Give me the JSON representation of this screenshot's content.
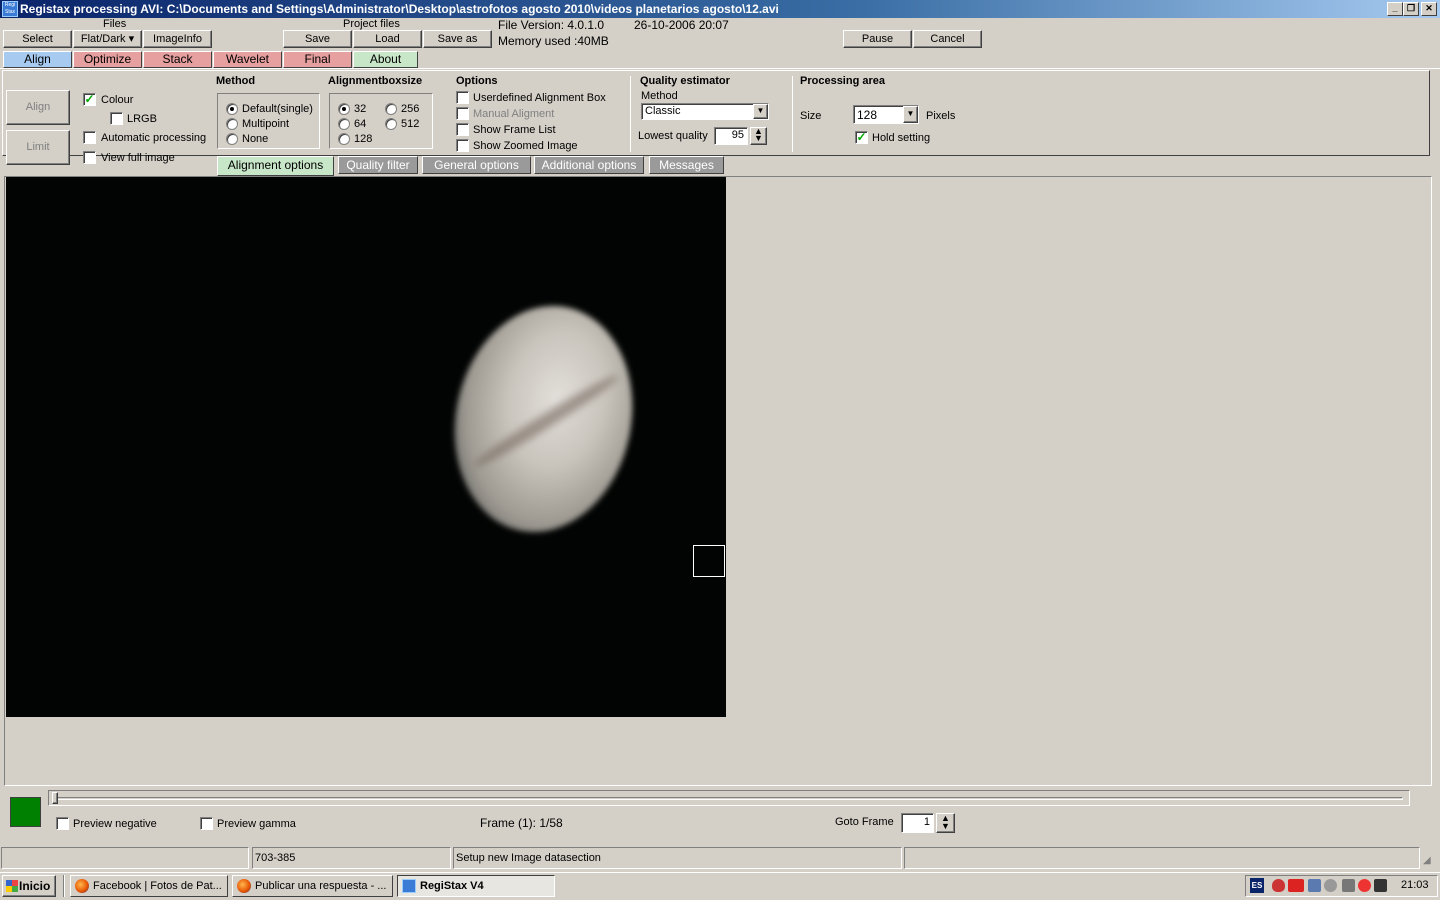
{
  "window": {
    "title": "Registax processing AVI: C:\\Documents and Settings\\Administrator\\Desktop\\astrofotos agosto 2010\\videos planetarios agosto\\12.avi",
    "icon_text": "Regi Stax"
  },
  "toolbar": {
    "select_label": "Select",
    "files_label": "Files",
    "flatdark_label": "Flat/Dark",
    "imageinfo_label": "ImageInfo",
    "project_files_label": "Project files",
    "save_label": "Save",
    "load_label": "Load",
    "saveas_label": "Save as",
    "file_version": "File Version: 4.0.1.0",
    "file_date": "26-10-2006 20:07",
    "memory_used": "Memory used :40MB",
    "pause_label": "Pause",
    "cancel_label": "Cancel"
  },
  "tabs": [
    {
      "label": "Align",
      "color": "#a6caf0"
    },
    {
      "label": "Optimize",
      "color": "#e6a0a0"
    },
    {
      "label": "Stack",
      "color": "#e6a0a0"
    },
    {
      "label": "Wavelet",
      "color": "#e6a0a0"
    },
    {
      "label": "Final",
      "color": "#e6a0a0"
    },
    {
      "label": "About",
      "color": "#c8e6c8"
    }
  ],
  "left": {
    "align_label": "Align",
    "limit_label": "Limit",
    "colour_label": "Colour",
    "colour_checked": true,
    "lrgb_label": "LRGB",
    "auto_label": "Automatic processing",
    "fullimage_label": "View full image"
  },
  "method": {
    "title": "Method",
    "options": [
      "Default(single)",
      "Multipoint",
      "None"
    ],
    "selected": "Default(single)"
  },
  "boxsize": {
    "title": "Alignmentboxsize",
    "options": [
      "32",
      "64",
      "128",
      "256",
      "512"
    ],
    "selected": "32"
  },
  "options": {
    "title": "Options",
    "items": [
      "Userdefined Alignment Box",
      "Manual Aligment",
      "Show Frame List",
      "Show Zoomed Image"
    ]
  },
  "quality": {
    "title": "Quality estimator",
    "method_label": "Method",
    "method_value": "Classic",
    "lowest_label": "Lowest quality",
    "lowest_value": "95"
  },
  "processing": {
    "title": "Processing area",
    "size_label": "Size",
    "size_value": "128",
    "pixels_label": "Pixels",
    "hold_label": "Hold setting",
    "hold_checked": true
  },
  "subtabs": [
    "Alignment  options",
    "Quality  filter",
    "General options",
    "Additional options",
    "Messages"
  ],
  "bottom": {
    "preview_negative": "Preview negative",
    "preview_gamma": "Preview gamma",
    "frame_text": "Frame (1): 1/58",
    "goto_label": "Goto Frame",
    "goto_value": "1",
    "color_swatch": "#008000"
  },
  "status": {
    "coords": "703-385",
    "message": "Setup new Image datasection"
  },
  "taskbar": {
    "start_label": "Inicio",
    "items": [
      "Facebook | Fotos de Pat...",
      "Publicar una respuesta - ...",
      "RegiStax V4"
    ],
    "lang": "ES",
    "clock": "21:03"
  }
}
